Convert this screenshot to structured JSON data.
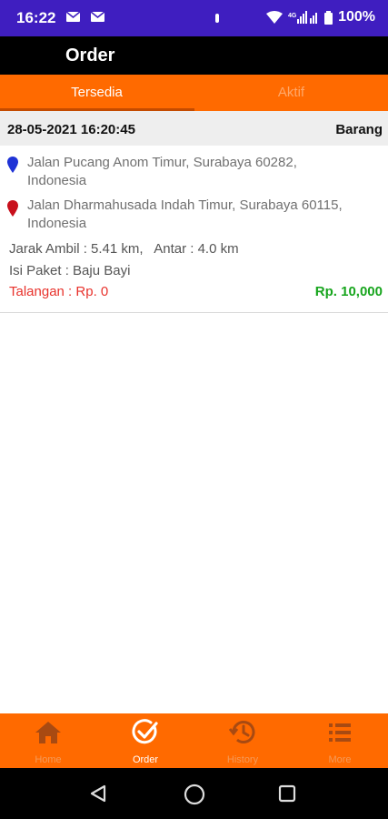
{
  "status_bar": {
    "time": "16:22",
    "battery": "100%"
  },
  "app_bar": {
    "title": "Order"
  },
  "tabs": [
    {
      "label": "Tersedia",
      "selected": true
    },
    {
      "label": "Aktif",
      "selected": false
    }
  ],
  "order": {
    "datetime": "28-05-2021 16:20:45",
    "type": "Barang",
    "pickup_line1": "Jalan Pucang Anom Timur, Surabaya 60282,",
    "pickup_line2": "Indonesia",
    "dropoff_line1": "Jalan Dharmahusada Indah Timur, Surabaya 60115,",
    "dropoff_line2": "Indonesia",
    "distance": "Jarak Ambil : 5.41 km,   Antar : 4.0 km",
    "package": "Isi Paket : Baju Bayi",
    "talangan": "Talangan : Rp. 0",
    "price": "Rp. 10,000"
  },
  "bottom_nav": [
    {
      "label": "Home",
      "icon": "home-icon"
    },
    {
      "label": "Order",
      "icon": "check-circle-icon",
      "active": true
    },
    {
      "label": "History",
      "icon": "history-icon"
    },
    {
      "label": "More",
      "icon": "list-icon"
    }
  ],
  "colors": {
    "status_bar": "#3f1ec0",
    "accent": "#ff6a00",
    "price": "#17a51d",
    "talangan": "#e8322c",
    "pickup_pin": "#1f33d6",
    "dropoff_pin": "#c8101c"
  }
}
